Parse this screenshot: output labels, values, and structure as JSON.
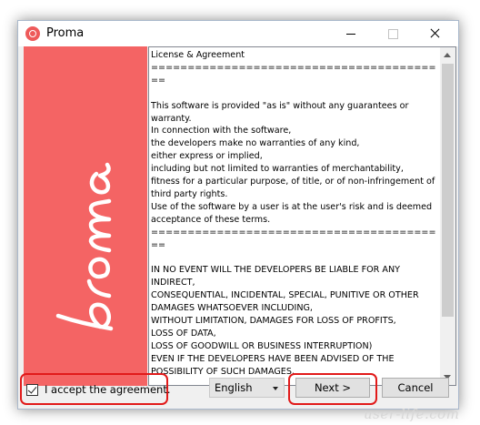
{
  "window": {
    "title": "Proma",
    "min_icon": "minimize-icon",
    "max_icon": "maximize-icon",
    "close_icon": "close-icon"
  },
  "brand": {
    "logo_text": "proma",
    "panel_color": "#f46464"
  },
  "license": {
    "text": "License & Agreement\n=========================================\n\nThis software is provided \"as is\" without any guarantees or warranty.\nIn connection with the software,\nthe developers make no warranties of any kind,\neither express or implied,\nincluding but not limited to warranties of merchantability,\nfitness for a particular purpose, of title, or of non-infringement of third party rights.\nUse of the software by a user is at the user's risk and is deemed acceptance of these terms.\n=========================================\n\nIN NO EVENT WILL THE DEVELOPERS BE LIABLE FOR ANY INDIRECT,\nCONSEQUENTIAL, INCIDENTAL, SPECIAL, PUNITIVE OR OTHER DAMAGES WHATSOEVER INCLUDING,\nWITHOUT LIMITATION, DAMAGES FOR LOSS OF PROFITS,\nLOSS OF DATA,\nLOSS OF GOODWILL OR BUSINESS INTERRUPTION)\nEVEN IF THE DEVELOPERS HAVE BEEN ADVISED OF THE POSSIBILITY OF SUCH DAMAGES,"
  },
  "footer": {
    "accept_label": "I accept the agreement.",
    "accept_checked": true,
    "language_selected": "English",
    "next_label": "Next >",
    "cancel_label": "Cancel"
  },
  "highlight_color": "#e11a1a",
  "watermark": "user-life.com"
}
